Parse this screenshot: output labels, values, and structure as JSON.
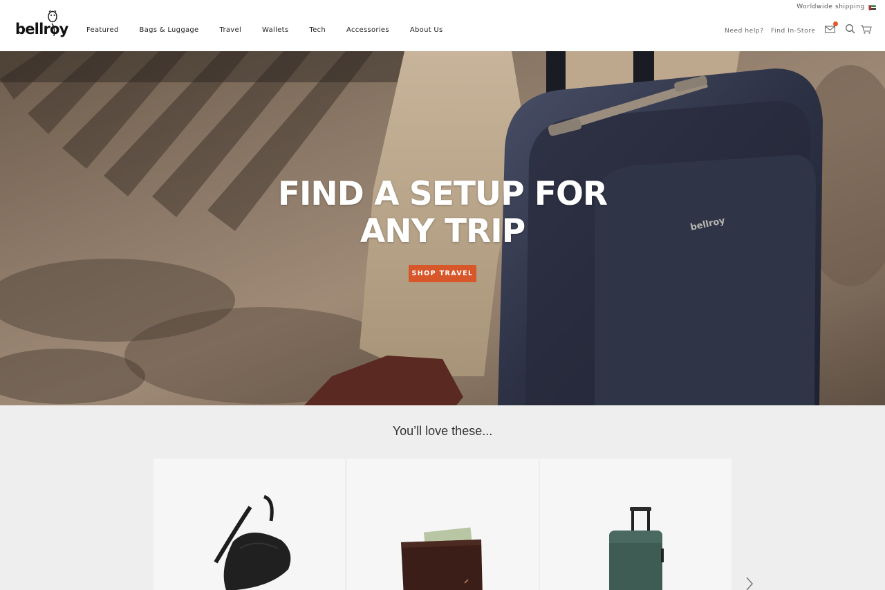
{
  "header": {
    "logo_text": "bellroy",
    "shipping_text": "Worldwide shipping",
    "nav": [
      "Featured",
      "Bags & Luggage",
      "Travel",
      "Wallets",
      "Tech",
      "Accessories",
      "About Us"
    ],
    "help_label": "Need help?",
    "store_label": "Find In-Store",
    "icons": [
      "mail-icon",
      "search-icon",
      "cart-icon"
    ]
  },
  "hero": {
    "line1": "FIND A SETUP FOR",
    "line2": "ANY TRIP",
    "button": "SHOP TRAVEL",
    "suitcase_brand": "bellroy"
  },
  "products": {
    "title": "You’ll love these...",
    "items": [
      "sling-bag",
      "wallet",
      "suitcase"
    ]
  },
  "colors": {
    "accent": "#d8572a",
    "section_bg": "#eeeeee",
    "card_bg": "#f6f6f6"
  }
}
